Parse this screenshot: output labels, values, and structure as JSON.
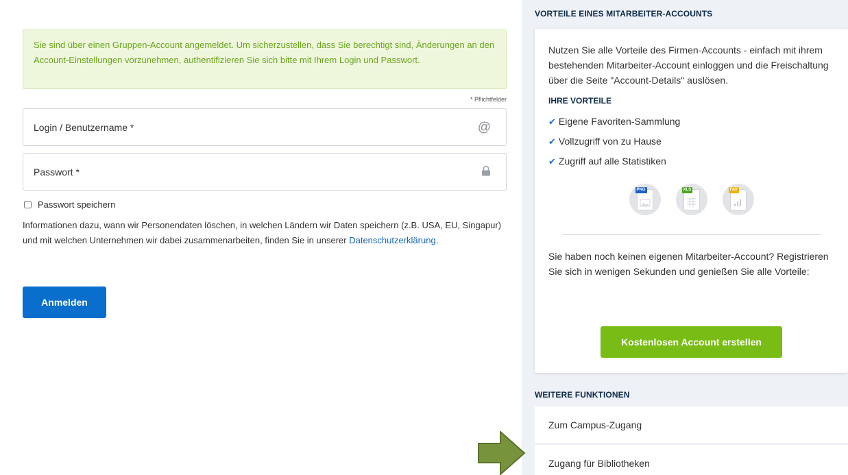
{
  "login": {
    "notice": "Sie sind über einen Gruppen-Account angemeldet. Um sicherzustellen, dass Sie berechtigt sind, Änderungen an den Account-Einstellungen vorzunehmen, authentifizieren Sie sich bitte mit Ihrem Login und Passwort.",
    "required_note": "* Pflichtfelder",
    "username_placeholder": "Login / Benutzername *",
    "username_icon": "at-icon",
    "password_placeholder": "Passwort *",
    "password_icon": "lock-icon",
    "remember_label": "Passwort speichern",
    "privacy_text": "Informationen dazu, wann wir Personendaten löschen, in welchen Ländern wir Daten speichern (z.B. USA, EU, Singapur) und mit welchen Unternehmen wir dabei zusammenarbeiten, finden Sie in unserer",
    "privacy_link": "Datenschutzerklärung",
    "privacy_end": ".",
    "submit_label": "Anmelden",
    "submit_color": "#0a6ecd",
    "notice_color": "#6aa51e"
  },
  "sidebar": {
    "benefits_title": "VORTEILE EINES MITARBEITER-ACCOUNTS",
    "intro": "Nutzen Sie alle Vorteile des Firmen-Accounts - einfach mit ihrem bestehenden Mitarbeiter-Account einloggen und die Freischaltung über die Seite \"Account-Details\" auslösen.",
    "your_benefits": "IHRE VORTEILE",
    "benefits": [
      "Eigene Favoriten-Sammlung",
      "Vollzugriff von zu Hause",
      "Zugriff auf alle Statistiken"
    ],
    "badges": [
      {
        "label": "PNG",
        "color": "#1c5fc2",
        "icon": "png-file-icon"
      },
      {
        "label": "XLS",
        "color": "#4aa41f",
        "icon": "xls-file-icon"
      },
      {
        "label": "FAV",
        "color": "#f0b400",
        "icon": "fav-file-icon"
      }
    ],
    "outro": "Sie haben noch keinen eigenen Mitarbeiter-Account? Registrieren Sie sich in wenigen Sekunden und genießen Sie alle Vorteile:",
    "create_label": "Kostenlosen Account erstellen",
    "create_color": "#78bc15",
    "more_title": "WEITERE FUNKTIONEN",
    "links": [
      "Zum Campus-Zugang",
      "Zugang für Bibliotheken"
    ]
  }
}
